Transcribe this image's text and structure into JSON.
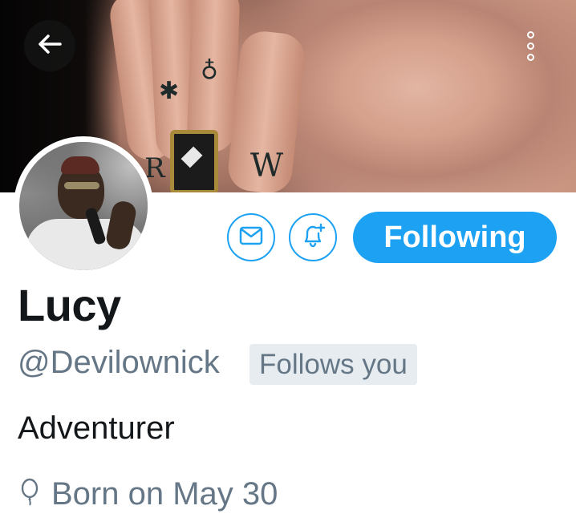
{
  "header": {
    "back_icon": "arrow-left-icon",
    "more_icon": "vertical-dots-icon"
  },
  "actions": {
    "message_icon": "envelope-icon",
    "notify_icon": "bell-plus-icon",
    "follow_label": "Following"
  },
  "profile": {
    "name": "Lucy",
    "handle": "@Devilownick",
    "follows_badge": "Follows you",
    "bio": "Adventurer",
    "birth_icon": "balloon-icon",
    "birth": "Born on May 30"
  },
  "colors": {
    "accent": "#1da1f2",
    "secondary_text": "#657786",
    "primary_text": "#14171a",
    "badge_bg": "#e6ecf0"
  }
}
